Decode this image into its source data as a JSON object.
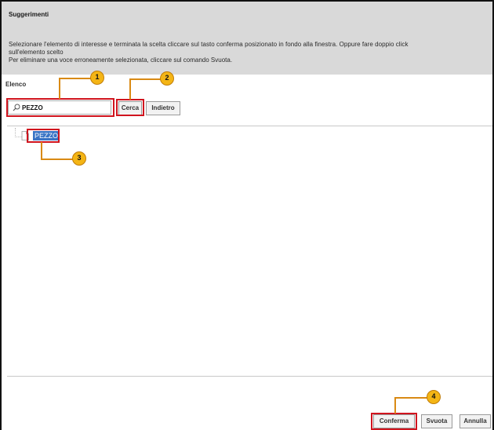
{
  "dialog": {
    "title": "Suggerimenti",
    "instructions": [
      "Selezionare l'elemento di interesse e terminata la scelta cliccare sul tasto conferma posizionato in fondo alla finestra. Oppure fare doppio click",
      "sull'elemento scelto",
      "Per eliminare una voce erroneamente selezionata, cliccare sul comando Svuota."
    ]
  },
  "search": {
    "section_label": "Elenco",
    "value": "PEZZO",
    "icon": "search-icon",
    "search_button": "Cerca",
    "back_button": "Indietro"
  },
  "tree": {
    "items": [
      {
        "label": "PEZZO",
        "icon": "document-icon",
        "selected": true
      }
    ]
  },
  "footer": {
    "confirm": "Conferma",
    "clear": "Svuota",
    "cancel": "Annulla"
  },
  "callouts": [
    "1",
    "2",
    "3",
    "4"
  ],
  "colors": {
    "header_bg": "#d9d9d9",
    "highlight": "#d0141e",
    "callout_fill": "#f4b515",
    "selection": "#3a74c5"
  }
}
